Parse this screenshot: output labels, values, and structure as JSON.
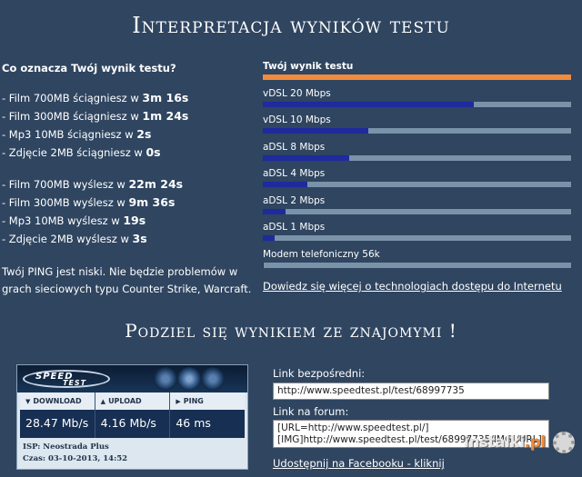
{
  "titles": {
    "main": "Interpretacja wyników testu",
    "share": "Podziel się wynikiem ze znajomymi !"
  },
  "interpretation": {
    "question": "Co oznacza Twój wynik testu?",
    "download": [
      {
        "prefix": "- Film 700MB ściągniesz w ",
        "value": "3m 16s"
      },
      {
        "prefix": "- Film 300MB ściągniesz w ",
        "value": "1m 24s"
      },
      {
        "prefix": "- Mp3 10MB ściągniesz w ",
        "value": "2s"
      },
      {
        "prefix": "- Zdjęcie 2MB ściągniesz w ",
        "value": "0s"
      }
    ],
    "upload": [
      {
        "prefix": "- Film 700MB wyślesz w ",
        "value": "22m 24s"
      },
      {
        "prefix": "- Film 300MB wyślesz w ",
        "value": "9m 36s"
      },
      {
        "prefix": "- Mp3 10MB wyślesz w ",
        "value": "19s"
      },
      {
        "prefix": "- Zdjęcie 2MB wyślesz w ",
        "value": "3s"
      }
    ],
    "ping_text": "Twój PING jest niski. Nie będzie problemów w grach sieciowych typu Counter Strike, Warcraft."
  },
  "comparison": {
    "bars": [
      {
        "label": "Twój wynik testu",
        "fraction": 1.0,
        "highlight": true
      },
      {
        "label": "vDSL 20 Mbps",
        "fraction": 0.685,
        "highlight": false
      },
      {
        "label": "vDSL 10 Mbps",
        "fraction": 0.343,
        "highlight": false
      },
      {
        "label": "aDSL 8 Mbps",
        "fraction": 0.28,
        "highlight": false
      },
      {
        "label": "aDSL 4 Mbps",
        "fraction": 0.145,
        "highlight": false
      },
      {
        "label": "aDSL 2 Mbps",
        "fraction": 0.075,
        "highlight": false
      },
      {
        "label": "aDSL 1 Mbps",
        "fraction": 0.038,
        "highlight": false
      },
      {
        "label": "Modem telefoniczny 56k",
        "fraction": 0.003,
        "highlight": false
      }
    ],
    "link": "Dowiedz się więcej o technologiach dostępu do Internetu"
  },
  "widget": {
    "logo_top": "SPEED",
    "logo_bottom": "TEST",
    "download_label": "DOWNLOAD",
    "upload_label": "UPLOAD",
    "ping_label": "PING",
    "download_value": "28.47 Mb/s",
    "upload_value": "4.16 Mb/s",
    "ping_value": "46 ms",
    "isp": "ISP: Neostrada Plus",
    "time": "Czas: 03-10-2013, 14:52"
  },
  "share": {
    "direct_label": "Link bezpośredni:",
    "direct_value": "http://www.speedtest.pl/test/68997735",
    "forum_label": "Link na forum:",
    "forum_line1": "[URL=http://www.speedtest.pl/]",
    "forum_line2": "[IMG]http://www.speedtest.pl/test/68997735/IMG[/URL]",
    "facebook_link": "Udostępnij na Facebooku - kliknij"
  },
  "watermark": {
    "text_a": "instalki",
    "text_b": ".pl"
  }
}
